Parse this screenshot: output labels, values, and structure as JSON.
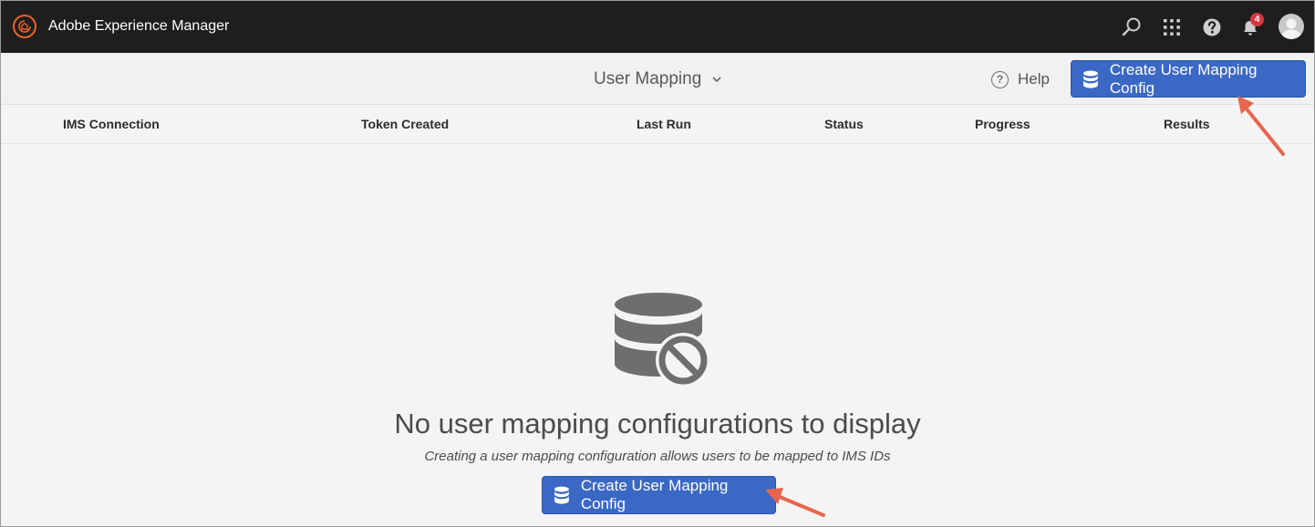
{
  "app": {
    "title": "Adobe Experience Manager",
    "logo_icon": "adobe-experience-cloud-logo"
  },
  "shell": {
    "icons": [
      "search-icon",
      "apps-grid-icon",
      "help-icon",
      "notifications-bell-icon",
      "user-avatar"
    ],
    "notification_count": "4"
  },
  "actionbar": {
    "title": "User Mapping",
    "help_label": "Help",
    "help_icon_glyph": "?",
    "create_button_label": "Create User Mapping Config"
  },
  "table": {
    "columns": [
      "IMS Connection",
      "Token Created",
      "Last Run",
      "Status",
      "Progress",
      "Results"
    ]
  },
  "empty_state": {
    "title": "No user mapping configurations to display",
    "subtitle": "Creating a user mapping configuration allows users to be mapped to IMS IDs",
    "button_label": "Create User Mapping Config",
    "icon": "database-blocked-icon"
  },
  "colors": {
    "shell_bg": "#1e1e1e",
    "primary_button": "#3b68c4",
    "notification_badge": "#d7373f",
    "callout_arrow": "#e8654f",
    "logo_accent": "#e8622c"
  }
}
